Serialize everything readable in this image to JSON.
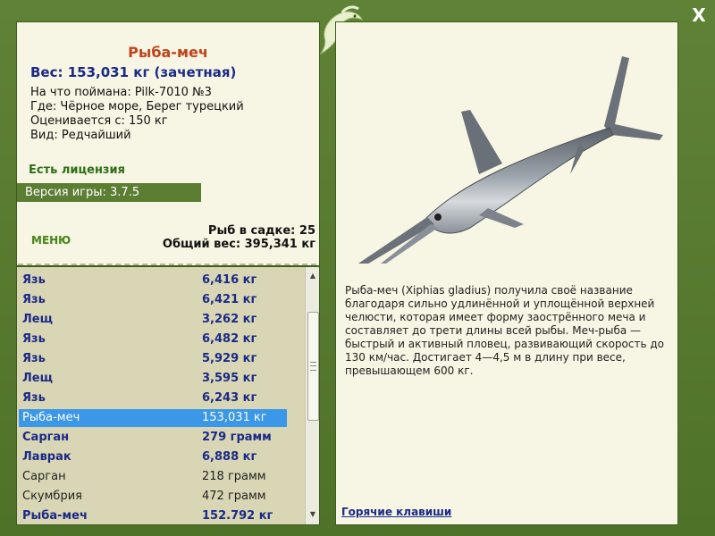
{
  "fish": {
    "title": "Рыба-меч",
    "weight": "Вес: 153,031 кг (зачетная)",
    "caught_on": "На что поймана: Pilk-7010 №3",
    "location": "Где: Чёрное море, Берег турецкий",
    "value": "Оценивается с: 150 кг",
    "rarity": "Вид: Редчайший",
    "license": "Есть лицензия",
    "version": "Версия игры: 3.7.5",
    "description": "Рыба-меч (Xiphias gladius) получила своё название благодаря сильно удлинённой и уплощённой верхней челюсти, которая имеет форму заострённого меча и составляет до трети длины всей рыбы. Меч-рыба — быстрый и активный пловец, развивающий скорость до 130 км/час. Достигает 4—4,5 м в длину при весе, превышающем 600 кг."
  },
  "menu_label": "МЕНЮ",
  "cage": {
    "count_line": "Рыб в садке: 25",
    "total_line": "Общий вес: 395,341 кг"
  },
  "list": [
    {
      "name": "Язь",
      "weight": "6,416 кг",
      "style": "bold"
    },
    {
      "name": "Язь",
      "weight": "6,421 кг",
      "style": "bold"
    },
    {
      "name": "Лещ",
      "weight": "3,262 кг",
      "style": "bold"
    },
    {
      "name": "Язь",
      "weight": "6,482 кг",
      "style": "bold"
    },
    {
      "name": "Язь",
      "weight": "5,929 кг",
      "style": "bold"
    },
    {
      "name": "Лещ",
      "weight": "3,595 кг",
      "style": "bold"
    },
    {
      "name": "Язь",
      "weight": "6,243 кг",
      "style": "bold"
    },
    {
      "name": "Рыба-меч",
      "weight": "153,031 кг",
      "style": "selected"
    },
    {
      "name": "Сарган",
      "weight": "279 грамм",
      "style": "bold"
    },
    {
      "name": "Лаврак",
      "weight": "6,888 кг",
      "style": "bold"
    },
    {
      "name": "Сарган",
      "weight": "218 грамм",
      "style": "plain"
    },
    {
      "name": "Скумбрия",
      "weight": "472 грамм",
      "style": "plain"
    },
    {
      "name": "Рыба-меч",
      "weight": "152.792 кг",
      "style": "bold"
    }
  ],
  "hotkeys_label": "Горячие клавиши",
  "close_label": "X",
  "icons": {
    "logo": "lizard-logo-icon",
    "close": "close-icon",
    "scroll_up": "scroll-up-icon",
    "scroll_down": "scroll-down-icon"
  },
  "colors": {
    "background": "#567a2f",
    "panel": "#f7f5e3",
    "title": "#c0441c",
    "accent_text": "#1b2a86",
    "selected": "#3b97e8",
    "license": "#2f6e18"
  }
}
